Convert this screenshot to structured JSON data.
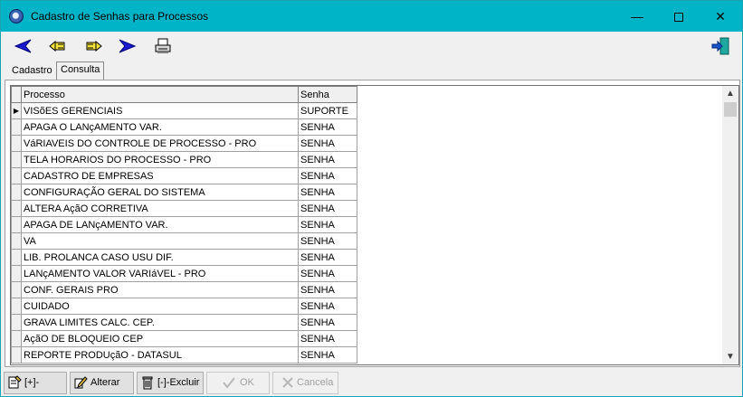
{
  "window": {
    "title": "Cadastro de Senhas para Processos",
    "minimize_glyph": "—",
    "close_glyph": "✕"
  },
  "toolbar": {
    "icons": [
      "first-record-icon",
      "previous-record-icon",
      "next-record-icon",
      "last-record-icon",
      "print-icon",
      "exit-icon"
    ]
  },
  "tabs": [
    {
      "label": "Cadastro",
      "active": false
    },
    {
      "label": "Consulta",
      "active": true
    }
  ],
  "grid": {
    "columns": [
      "Processo",
      "Senha"
    ],
    "current_row_indicator": "▶",
    "rows": [
      {
        "processo": "VISõES GERENCIAIS",
        "senha": "SUPORTE"
      },
      {
        "processo": "APAGA O LANçAMENTO VAR.",
        "senha": "SENHA"
      },
      {
        "processo": "VáRIAVEIS DO CONTROLE DE PROCESSO - PRO",
        "senha": "SENHA"
      },
      {
        "processo": "TELA HORARIOS DO PROCESSO - PRO",
        "senha": "SENHA"
      },
      {
        "processo": "CADASTRO DE EMPRESAS",
        "senha": "SENHA"
      },
      {
        "processo": "CONFIGURAÇÃO GERAL DO SISTEMA",
        "senha": "SENHA"
      },
      {
        "processo": "ALTERA AçãO CORRETIVA",
        "senha": "SENHA"
      },
      {
        "processo": "APAGA DE LANçAMENTO VAR.",
        "senha": "SENHA"
      },
      {
        "processo": "VA",
        "senha": "SENHA"
      },
      {
        "processo": "LIB. PROLANCA CASO USU DIF.",
        "senha": "SENHA"
      },
      {
        "processo": "LANçAMENTO VALOR VARIáVEL - PRO",
        "senha": "SENHA"
      },
      {
        "processo": "CONF. GERAIS PRO",
        "senha": "SENHA"
      },
      {
        "processo": "CUIDADO",
        "senha": "SENHA"
      },
      {
        "processo": "GRAVA LIMITES CALC. CEP.",
        "senha": "SENHA"
      },
      {
        "processo": "AçãO DE BLOQUEIO CEP",
        "senha": "SENHA"
      },
      {
        "processo": "REPORTE PRODUçãO - DATASUL",
        "senha": "SENHA"
      }
    ]
  },
  "scrollbar": {
    "up": "▲",
    "down": "▼"
  },
  "buttons": {
    "inserir": "[+]-Inserir",
    "alterar": "Alterar",
    "excluir": "[-]-Excluir",
    "ok": "OK",
    "cancela": "Cancela"
  }
}
